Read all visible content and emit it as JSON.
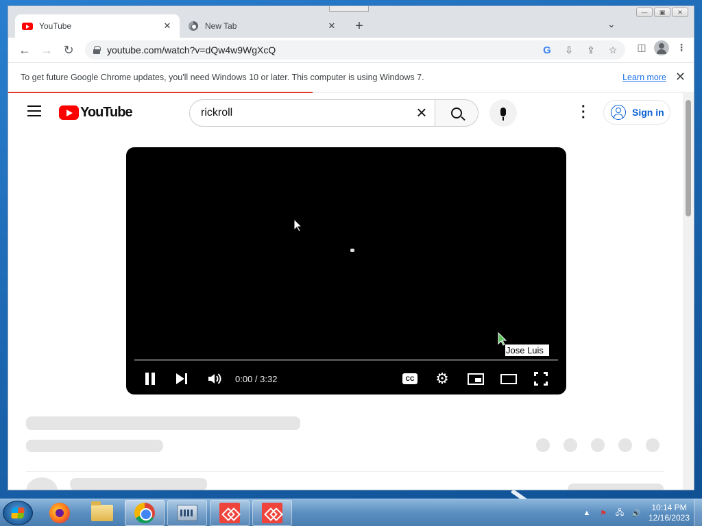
{
  "browser": {
    "tabs": [
      {
        "label": "YouTube",
        "active": true,
        "icon": "youtube-favicon"
      },
      {
        "label": "New Tab",
        "active": false,
        "icon": "chrome-favicon"
      }
    ],
    "url": "youtube.com/watch?v=dQw4w9WgXcQ",
    "infobar": {
      "message": "To get future Google Chrome updates, you'll need Windows 10 or later. This computer is using Windows 7.",
      "link": "Learn more"
    }
  },
  "youtube": {
    "logo_text": "YouTube",
    "search_query": "rickroll",
    "signin_label": "Sign in",
    "player": {
      "time": "0:00 / 3:32",
      "cc_label": "CC",
      "tooltip": "Jose Luis"
    }
  },
  "taskbar": {
    "time": "10:14 PM",
    "date": "12/16/2023"
  },
  "colors": {
    "youtube_red": "#ff0000",
    "link_blue": "#1a73e8",
    "signin_blue": "#065fd4",
    "progress_red": "#e2362b"
  }
}
